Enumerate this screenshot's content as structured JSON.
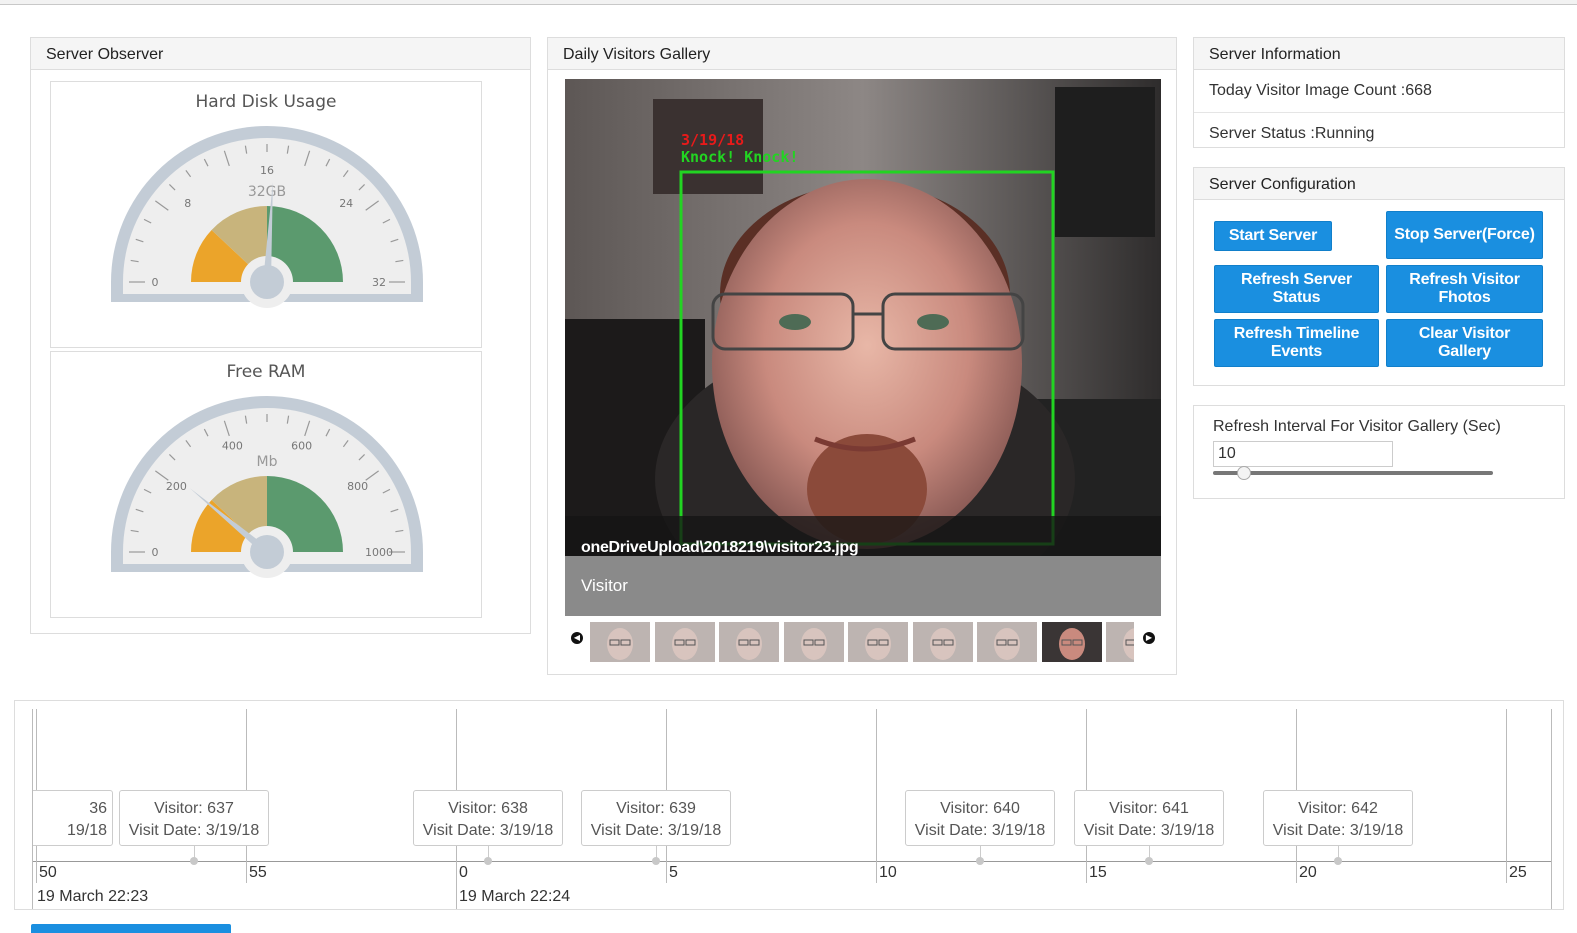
{
  "server_observer": {
    "title": "Server Observer",
    "disk_gauge": {
      "title": "Hard Disk Usage",
      "unit": "32GB",
      "min": 0,
      "max": 32,
      "value": 16.6,
      "ticks": [
        "0",
        "8",
        "16",
        "24",
        "32"
      ]
    },
    "ram_gauge": {
      "title": "Free RAM",
      "unit": "Mb",
      "min": 0,
      "max": 1000,
      "value": 220,
      "ticks": [
        "0",
        "200",
        "400",
        "600",
        "800",
        "1000"
      ]
    },
    "colors": {
      "band_low": "#eba42a",
      "band_mid": "#c8b47c",
      "band_high": "#5b9a6e",
      "rim": "#c3ccd6",
      "face": "#eeeeee"
    }
  },
  "gallery": {
    "title": "Daily Visitors Gallery",
    "overlay_date": "3/19/18",
    "overlay_text": "Knock! Knock!",
    "caption": "oneDriveUpload\\2018219\\visitor23.jpg",
    "label": "Visitor",
    "thumbnail_count": 9,
    "selected_thumbnail": 8
  },
  "server_info": {
    "title": "Server Information",
    "image_count": "Today Visitor Image Count :668",
    "status": "Server Status :Running"
  },
  "server_config": {
    "title": "Server Configuration",
    "buttons": {
      "start": "Start Server",
      "stop": "Stop Server(Force)",
      "refresh_status": "Refresh Server Status",
      "refresh_photos": "Refresh Visitor Fhotos",
      "refresh_timeline": "Refresh Timeline Events",
      "clear_gallery": "Clear Visitor Gallery"
    }
  },
  "refresh_interval": {
    "label": "Refresh Interval For Visitor Gallery (Sec)",
    "value": "10",
    "slider_fraction": 0.1
  },
  "timeline": {
    "ticks": [
      "50",
      "55",
      "0",
      "5",
      "10",
      "15",
      "20",
      "25"
    ],
    "major_labels": [
      "19 March 22:23",
      "19 March 22:24"
    ],
    "events": [
      {
        "title": "36",
        "date": "19/18"
      },
      {
        "title": "Visitor: 637",
        "date": "Visit Date: 3/19/18"
      },
      {
        "title": "Visitor: 638",
        "date": "Visit Date: 3/19/18"
      },
      {
        "title": "Visitor: 639",
        "date": "Visit Date: 3/19/18"
      },
      {
        "title": "Visitor: 640",
        "date": "Visit Date: 3/19/18"
      },
      {
        "title": "Visitor: 641",
        "date": "Visit Date: 3/19/18"
      },
      {
        "title": "Visitor: 642",
        "date": "Visit Date: 3/19/18"
      }
    ]
  }
}
